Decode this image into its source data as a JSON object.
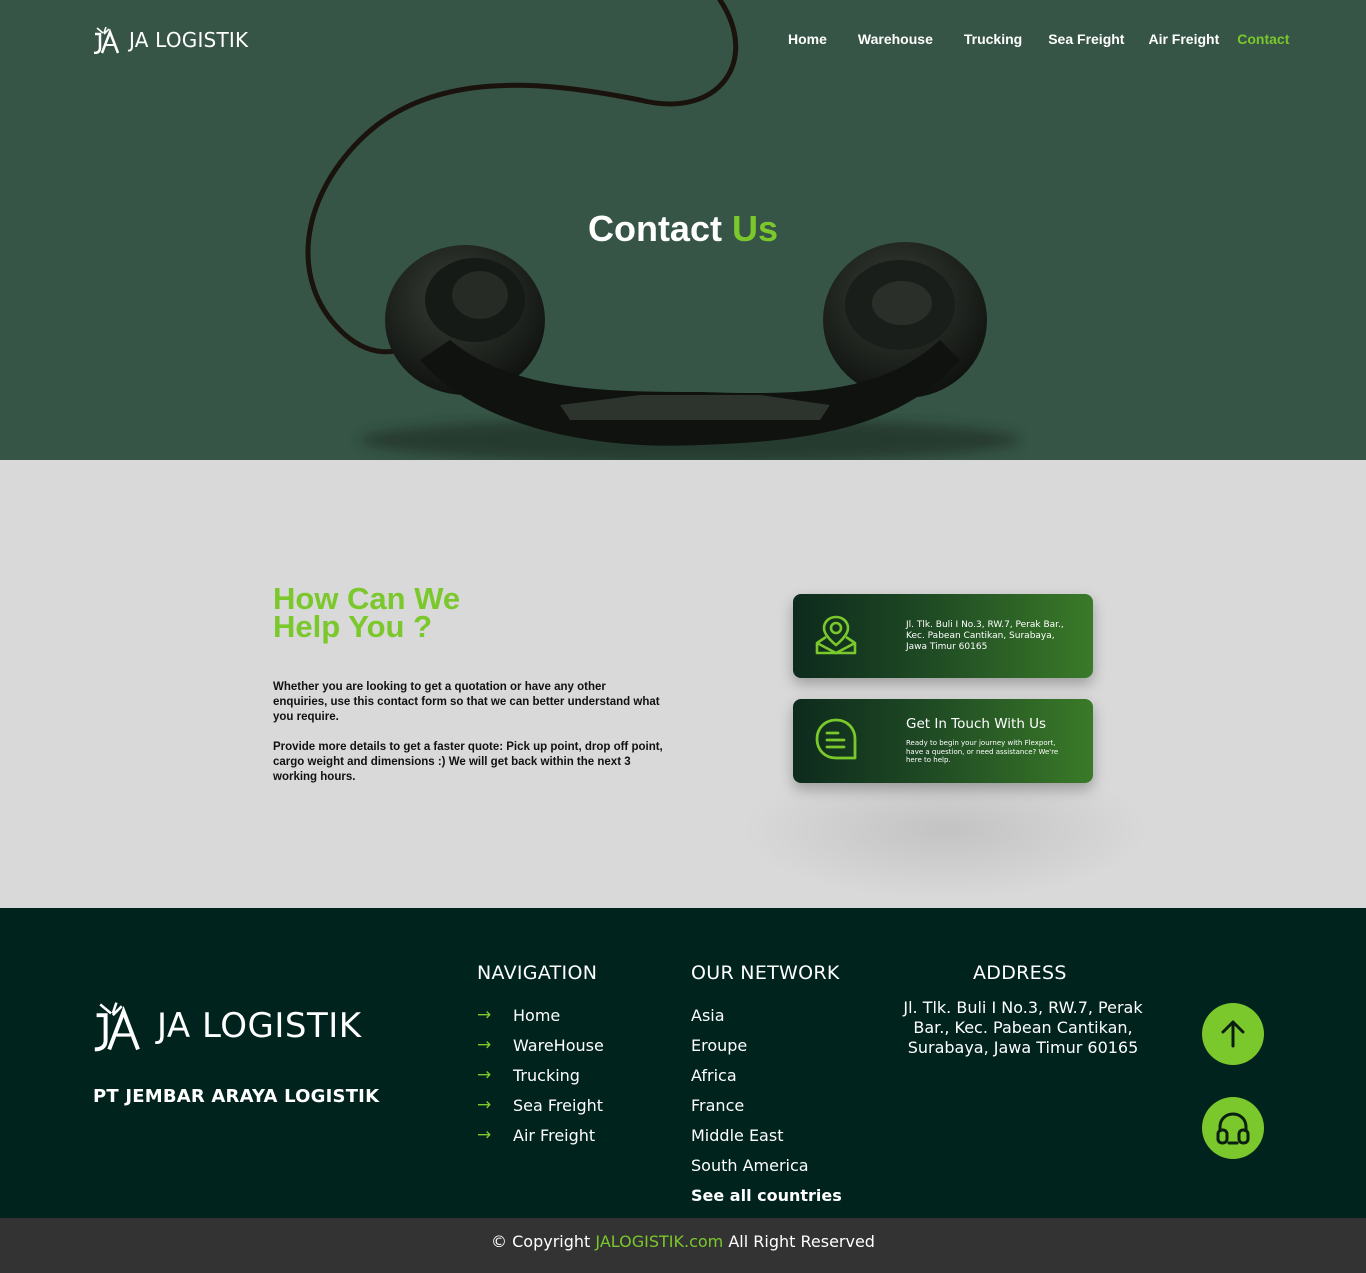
{
  "brand": {
    "name": "JA LOGISTIK"
  },
  "nav": {
    "items": [
      {
        "label": "Home"
      },
      {
        "label": "Warehouse"
      },
      {
        "label": "Trucking"
      },
      {
        "label": "Sea Freight"
      },
      {
        "label": "Air Freight"
      },
      {
        "label": "Contact",
        "active": true
      }
    ]
  },
  "hero": {
    "title_part1": "Contact",
    "title_part2": "Us"
  },
  "help": {
    "title": "How Can We Help You ?",
    "paragraph1": "Whether you are looking to get a quotation or have any other enquiries, use this contact form so that we can better understand what you require.",
    "paragraph2": "Provide more details to get a faster quote: Pick up point, drop off point, cargo weight and dimensions :) We will get back within the next 3 working hours."
  },
  "cards": {
    "address": {
      "icon": "map-pin-icon",
      "text": "Jl. Tlk. Buli I No.3, RW.7, Perak Bar., Kec. Pabean Cantikan, Surabaya, Jawa Timur 60165"
    },
    "contact": {
      "icon": "chat-bubble-icon",
      "title": "Get In Touch With Us",
      "text": "Ready to begin your journey with Flexport, have a question, or need assistance? We're here to help."
    }
  },
  "footer": {
    "brand": "JA LOGISTIK",
    "company": "PT JEMBAR ARAYA LOGISTIK",
    "navigation": {
      "title": "NAVIGATION",
      "items": [
        "Home",
        "WareHouse",
        "Trucking",
        "Sea Freight",
        "Air Freight"
      ]
    },
    "network": {
      "title": "OUR NETWORK",
      "items": [
        "Asia",
        "Eroupe",
        "Africa",
        "France",
        "Middle East",
        "South America",
        "See all countries"
      ]
    },
    "address": {
      "title": "ADDRESS",
      "text": "Jl. Tlk. Buli I No.3, RW.7, Perak Bar., Kec. Pabean Cantikan, Surabaya, Jawa Timur 60165"
    },
    "buttons": {
      "top_icon": "arrow-up-icon",
      "support_icon": "headset-icon"
    }
  },
  "copyright": {
    "prefix": "© Copyright",
    "site": "JALOGISTIK.com",
    "suffix": "All Right Reserved"
  },
  "colors": {
    "accent": "#7bc82c",
    "hero_bg": "#365546",
    "footer_bg": "#00231d",
    "copyright_bg": "#333333",
    "section_bg": "#d9d9d9"
  }
}
